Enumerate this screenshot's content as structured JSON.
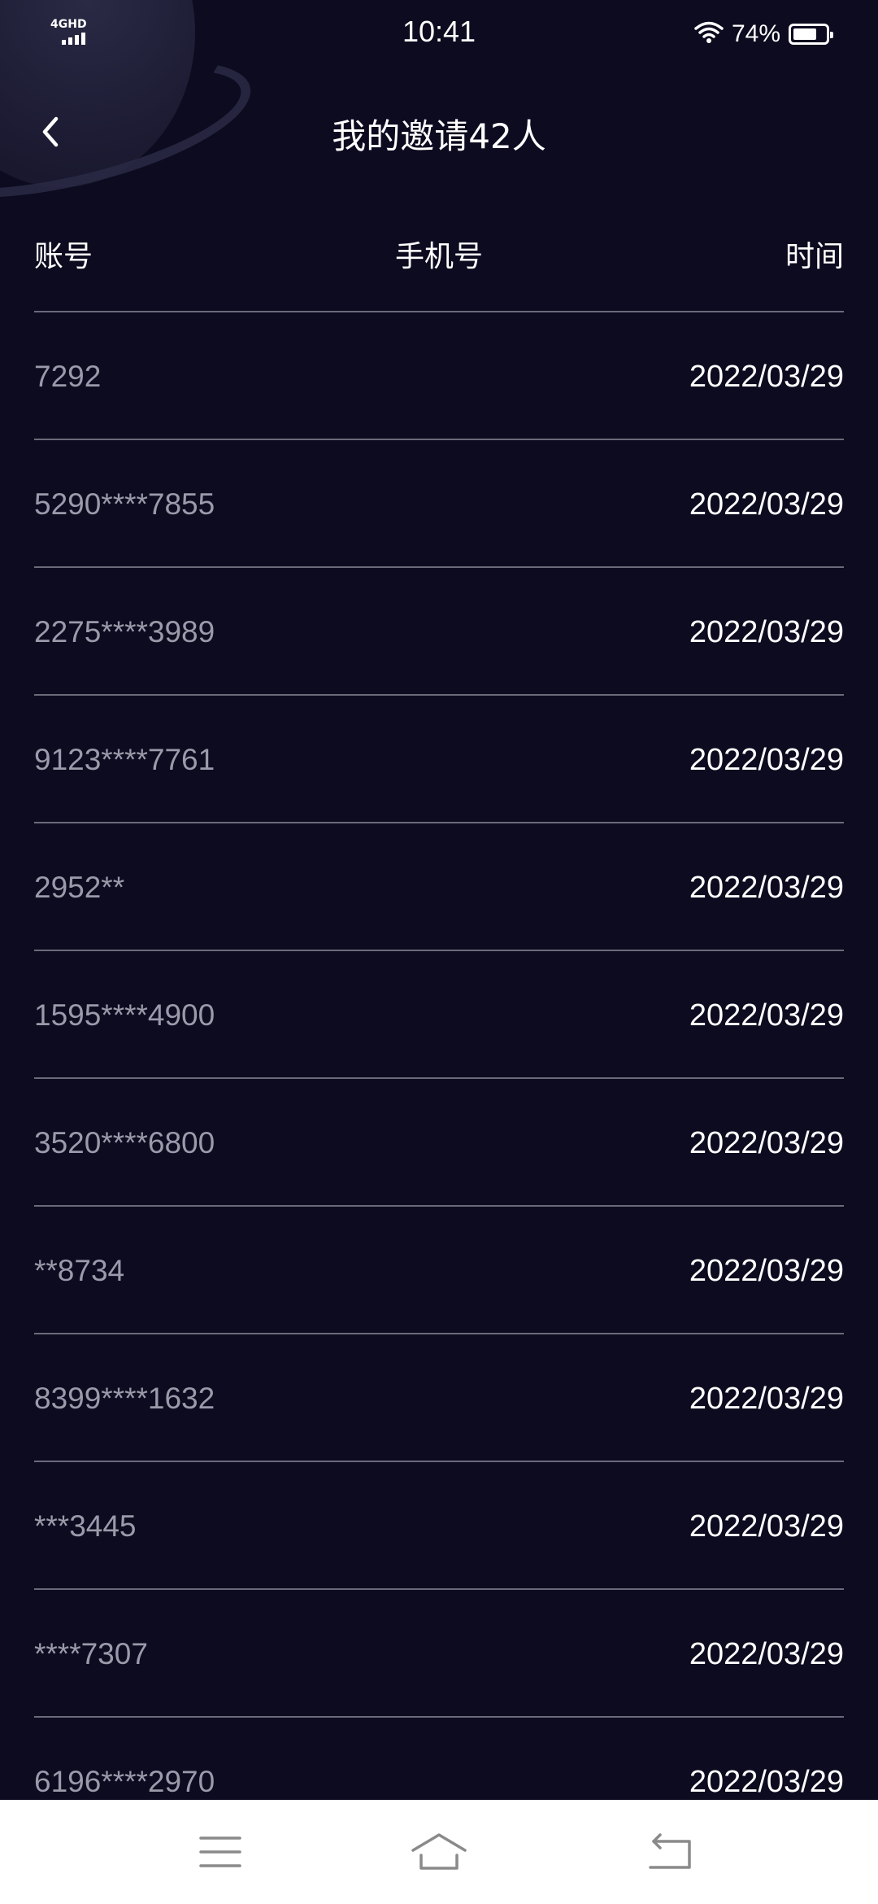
{
  "status_bar": {
    "network": "4GHD",
    "time": "10:41",
    "battery_percent": "74%",
    "battery_level": 0.74,
    "icons": [
      "signal-icon",
      "wifi-icon",
      "battery-icon"
    ]
  },
  "header": {
    "title": "我的邀请42人",
    "back_icon": "chevron-left-icon"
  },
  "table": {
    "columns": {
      "account": "账号",
      "phone": "手机号",
      "time": "时间"
    },
    "rows": [
      {
        "account": "7292",
        "date": "2022/03/29"
      },
      {
        "account": "5290****7855",
        "date": "2022/03/29"
      },
      {
        "account": "2275****3989",
        "date": "2022/03/29"
      },
      {
        "account": "9123****7761",
        "date": "2022/03/29"
      },
      {
        "account": "2952**",
        "date": "2022/03/29"
      },
      {
        "account": "1595****4900",
        "date": "2022/03/29"
      },
      {
        "account": "3520****6800",
        "date": "2022/03/29"
      },
      {
        "account": "**8734",
        "date": "2022/03/29"
      },
      {
        "account": "8399****1632",
        "date": "2022/03/29"
      },
      {
        "account": "***3445",
        "date": "2022/03/29"
      },
      {
        "account": "****7307",
        "date": "2022/03/29"
      },
      {
        "account": "6196****2970",
        "date": "2022/03/29"
      }
    ]
  },
  "system_nav": {
    "icons": [
      "menu-icon",
      "home-icon",
      "back-return-icon"
    ]
  },
  "colors": {
    "background": "#0c0b1f",
    "text": "#ffffff",
    "divider": "#6a6a7a",
    "nav_bar": "#ffffff"
  }
}
